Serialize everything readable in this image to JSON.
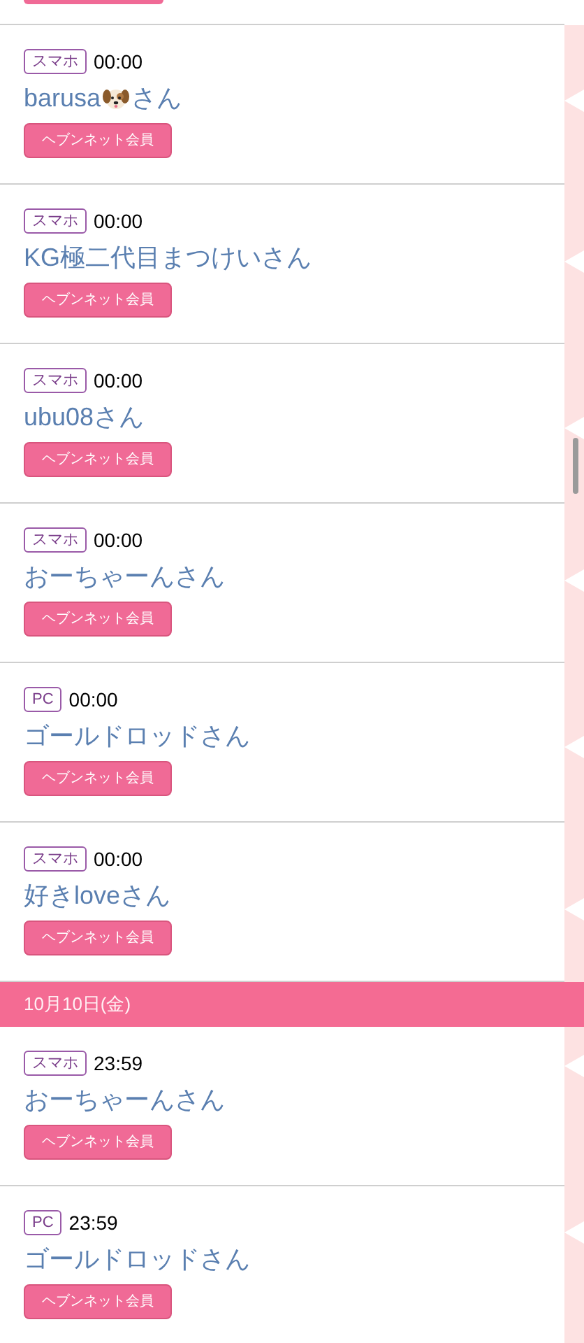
{
  "entries_before_cut": [
    {
      "kind": "badge_edge"
    }
  ],
  "groups": [
    {
      "entries": [
        {
          "device": "スマホ",
          "time": "00:00",
          "name": "barusa",
          "kind": "with_emoji",
          "name_suffix": "さん",
          "badge": "ヘブンネット会員"
        },
        {
          "device": "スマホ",
          "time": "00:00",
          "name": "KG極二代目まつけいさん",
          "badge": "ヘブンネット会員"
        },
        {
          "device": "スマホ",
          "time": "00:00",
          "name": "ubu08さん",
          "badge": "ヘブンネット会員"
        },
        {
          "device": "スマホ",
          "time": "00:00",
          "name": "おーちゃーんさん",
          "badge": "ヘブンネット会員"
        },
        {
          "device": "PC",
          "time": "00:00",
          "name": "ゴールドロッドさん",
          "badge": "ヘブンネット会員"
        },
        {
          "device": "スマホ",
          "time": "00:00",
          "name": "好きloveさん",
          "badge": "ヘブンネット会員"
        }
      ]
    },
    {
      "date": "10月10日(金)",
      "entries": [
        {
          "device": "スマホ",
          "time": "23:59",
          "name": "おーちゃーんさん",
          "badge": "ヘブンネット会員"
        },
        {
          "device": "PC",
          "time": "23:59",
          "name": "ゴールドロッドさん",
          "badge": "ヘブンネット会員"
        }
      ]
    }
  ]
}
